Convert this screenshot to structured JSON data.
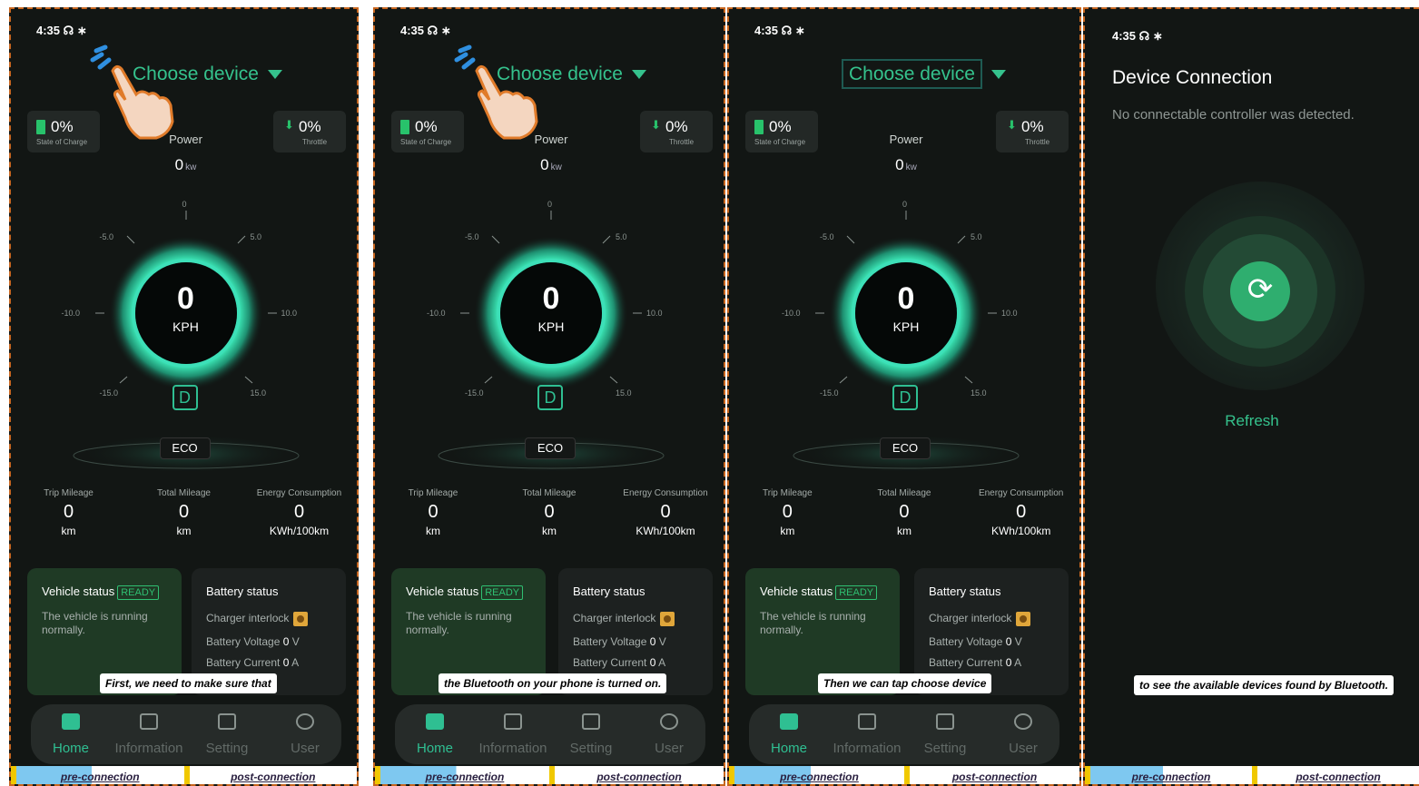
{
  "status_time": "4:35",
  "status_icons": "☊ ∗",
  "header": {
    "choose_device": "Choose device"
  },
  "soc": {
    "value": "0%",
    "label": "State of Charge"
  },
  "throttle": {
    "value": "0%",
    "label": "Throttle"
  },
  "power": {
    "label": "Power",
    "value": "0",
    "unit": "kw"
  },
  "gauge": {
    "speed": "0",
    "unit": "KPH",
    "gear": "D",
    "mode": "ECO",
    "ticks": [
      "0",
      "5.0",
      "-5.0",
      "10.0",
      "-10.0",
      "15.0",
      "-15.0"
    ]
  },
  "stats": [
    {
      "label": "Trip Mileage",
      "value": "0",
      "unit": "km"
    },
    {
      "label": "Total Mileage",
      "value": "0",
      "unit": "km"
    },
    {
      "label": "Energy Consumption",
      "value": "0",
      "unit": "KWh/100km"
    }
  ],
  "vehicle": {
    "title": "Vehicle status",
    "badge": "READY",
    "desc": "The vehicle is running normally."
  },
  "battery": {
    "title": "Battery status",
    "interlock": "Charger interlock",
    "voltage_label": "Battery Voltage",
    "voltage": "0",
    "voltage_unit": "V",
    "current_label": "Battery Current",
    "current": "0",
    "current_unit": "A"
  },
  "nav": [
    "Home",
    "Information",
    "Setting",
    "User"
  ],
  "captions": [
    "First, we need to make sure that",
    "the Bluetooth on your phone is turned on.",
    "Then we can tap choose device",
    "to see the available devices found by Bluetooth."
  ],
  "tabs": {
    "pre": "pre-connection",
    "post": "post-connection"
  },
  "device_connection": {
    "title": "Device Connection",
    "subtitle": "No connectable controller was detected.",
    "refresh": "Refresh"
  },
  "colors": {
    "accent": "#35c28d",
    "ready": "#2fbf72",
    "tab_border": "#f0c800"
  }
}
